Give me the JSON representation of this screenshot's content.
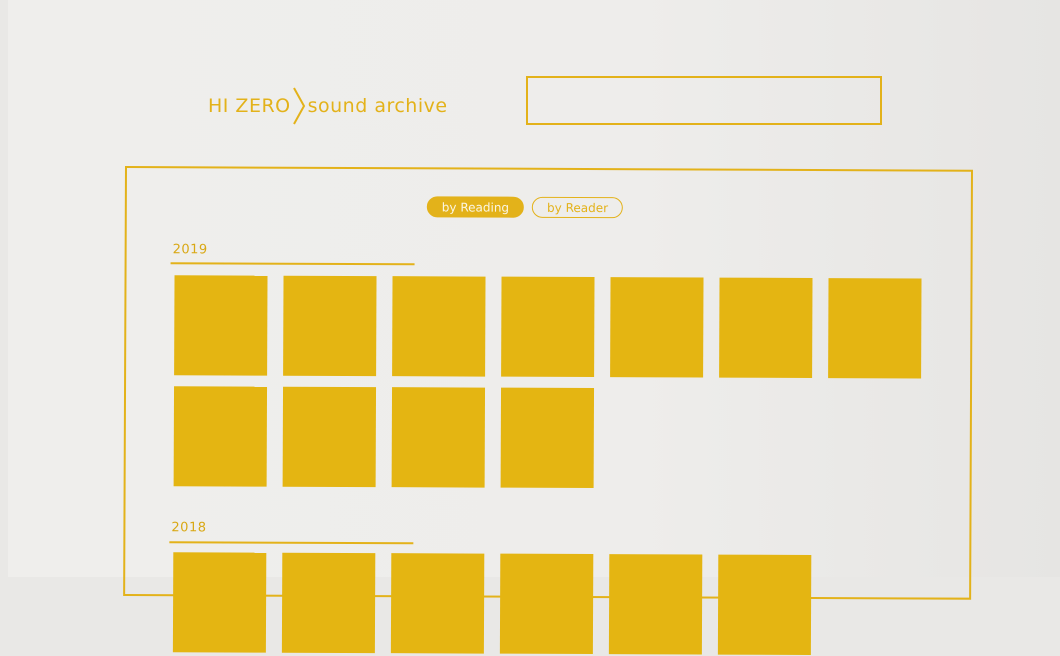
{
  "header": {
    "brand_main": "HI ZERO",
    "brand_sub": "sound archive",
    "search": {
      "value": "",
      "placeholder": ""
    }
  },
  "toggle": {
    "active_label": "by Reading",
    "inactive_label": "by Reader"
  },
  "sections": [
    {
      "year": "2019",
      "item_count": 11
    },
    {
      "year": "2018",
      "item_count": 6
    }
  ],
  "colors": {
    "accent": "#e3b21a",
    "tile": "#e4b512",
    "background": "#eeedeb"
  }
}
